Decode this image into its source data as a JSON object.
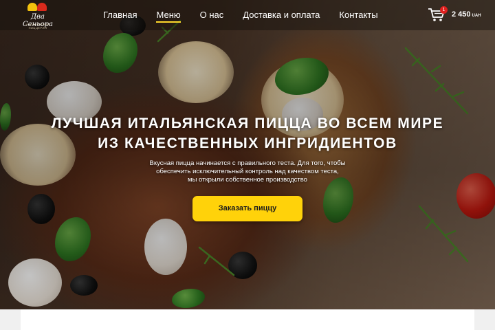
{
  "brand": {
    "name": "Два Сеньора",
    "tagline": "ИТАЛЬЯНСКАЯ ПИЦЦЕРИЯ"
  },
  "nav": {
    "items": [
      {
        "label": "Главная"
      },
      {
        "label": "Меню",
        "active": true
      },
      {
        "label": "О нас"
      },
      {
        "label": "Доставка и оплата"
      },
      {
        "label": "Контакты"
      }
    ]
  },
  "cart": {
    "count": "1",
    "total": "2 450",
    "currency": "UAH"
  },
  "hero": {
    "headline_line1": "ЛУЧШАЯ ИТАЛЬЯНСКАЯ ПИЦЦА ВО ВСЕМ МИРЕ",
    "headline_line2": "ИЗ КАЧЕСТВЕННЫХ ИНГРИДИЕНТОВ",
    "sub_line1": "Вкусная пицца начинается с правильного теста. Для того, чтобы",
    "sub_line2": "обеспечить исключительный контроль над качеством теста,",
    "sub_line3": "мы открыли собственное производство",
    "cta_label": "Заказать пиццу"
  },
  "colors": {
    "accent": "#ffd20a",
    "badge": "#e0201e",
    "active_underline": "#ffd92b"
  }
}
